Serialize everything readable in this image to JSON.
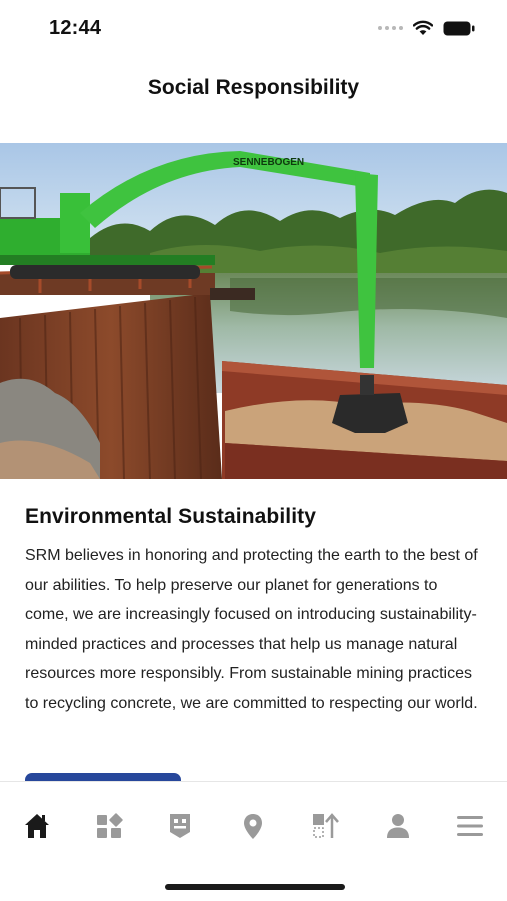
{
  "status_bar": {
    "time": "12:44",
    "icons": [
      "cellular-dots-icon",
      "wifi-icon",
      "battery-icon"
    ]
  },
  "header": {
    "title": "Social Responsibility"
  },
  "hero": {
    "machine_brand": "SENNEBOGEN"
  },
  "section": {
    "heading": "Environmental Sustainability",
    "body": "SRM believes in honoring and protecting the earth to the best of our abilities. To help preserve our planet for generations to come, we are increasingly focused on introducing sustainability-minded practices and processes that help us manage natural resources more responsibly. From sustainable mining practices to recycling concrete, we are committed to respecting our world."
  },
  "tab_bar": {
    "active": "home",
    "tabs": [
      {
        "icon": "home-icon"
      },
      {
        "icon": "products-grid-icon"
      },
      {
        "icon": "badge-icon"
      },
      {
        "icon": "location-pin-icon"
      },
      {
        "icon": "sort-upload-icon"
      },
      {
        "icon": "profile-icon"
      },
      {
        "icon": "menu-icon"
      }
    ]
  },
  "colors": {
    "accent": "#27479b",
    "active_icon": "#1a1a1a",
    "inactive_icon": "#9a9a9a",
    "machine_green": "#3fc33f"
  }
}
